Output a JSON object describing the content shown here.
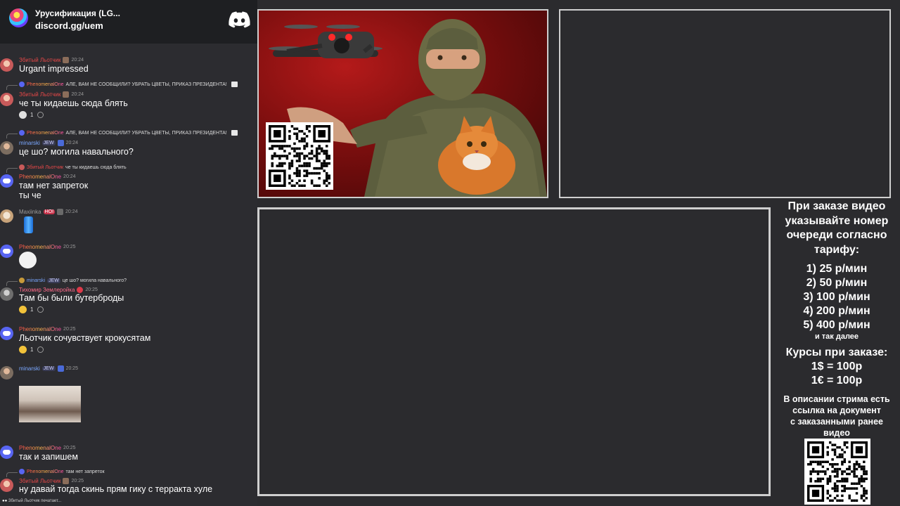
{
  "chat": {
    "server_name": "Урусификация (LG...",
    "server_link": "discord.gg/uem",
    "messages": [
      {
        "author": "Збитый Льотчик",
        "time": "20:24",
        "text": "Urgant impressed"
      },
      {
        "reply_author": "PhenomenalOne",
        "reply_text": "АЛЕ, ВАМ НЕ СООБЩИЛИ? УБРАТЬ ЦВЕТЫ, ПРИКАЗ ПРЕЗИДЕНТА!",
        "author": "Збитый Льотчик",
        "time": "20:24",
        "text": "че ты кидаешь сюда блять",
        "reaction_count": "1"
      },
      {
        "reply_author": "PhenomenalOne",
        "reply_text": "АЛЕ, ВАМ НЕ СООБЩИЛИ? УБРАТЬ ЦВЕТЫ, ПРИКАЗ ПРЕЗИДЕНТА!",
        "author": "minarski",
        "tag": "JEW",
        "time": "20:24",
        "text": "це шо? могила навального?"
      },
      {
        "reply_author": "Збитый Льотчик",
        "reply_text": "че ты кидаешь сюда блять",
        "author": "PhenomenalOne",
        "time": "20:24",
        "text": "там нет запреток",
        "text2": "ты че"
      },
      {
        "author": "Maxiinka",
        "tag": "HOI",
        "time": "20:24"
      },
      {
        "author": "PhenomenalOne",
        "time": "20:25"
      },
      {
        "reply_author": "minarski",
        "reply_tag": "JEW",
        "reply_text": "це шо? могила навального?",
        "author": "Тихомир Землеройка",
        "time": "20:25",
        "text": "Там бы были бутерброды",
        "reaction_count": "1"
      },
      {
        "author": "PhenomenalOne",
        "time": "20:25",
        "text": "Льотчик сочувствует крокусятам",
        "reaction_count": "1"
      },
      {
        "author": "minarski",
        "tag": "JEW",
        "time": "20:25"
      },
      {
        "author": "PhenomenalOne",
        "time": "20:25",
        "text": "так и запишем"
      },
      {
        "reply_author": "PhenomenalOne",
        "reply_text": "там нет запреток",
        "author": "Збитый Льотчик",
        "time": "20:25",
        "text": "ну давай тогда скинь прям гику с терракта хуле"
      }
    ],
    "typing": "Збитый Льотчик печатает..."
  },
  "info": {
    "heading": [
      "При заказе видео",
      "указывайте номер",
      "очереди согласно",
      "тарифу:"
    ],
    "prices": [
      "1) 25 р/мин",
      "2) 50 р/мин",
      "3) 100 р/мин",
      "4) 200 р/мин",
      "5) 400 р/мин"
    ],
    "etc": "и так далее",
    "rates_title": "Курсы при заказе:",
    "rates": [
      "1$ = 100р",
      "1€ = 100р"
    ],
    "desc": [
      "В описании стрима есть",
      "ссылка на документ",
      "с заказанными ранее",
      "видео"
    ]
  },
  "colors": {
    "accent": "#5865f2",
    "panel": "#2b2b2e",
    "header": "#1e1f22"
  },
  "icons": [
    "discord-logo-icon",
    "image-icon",
    "reply-icon",
    "add-reaction-icon",
    "qr-code-icon"
  ]
}
